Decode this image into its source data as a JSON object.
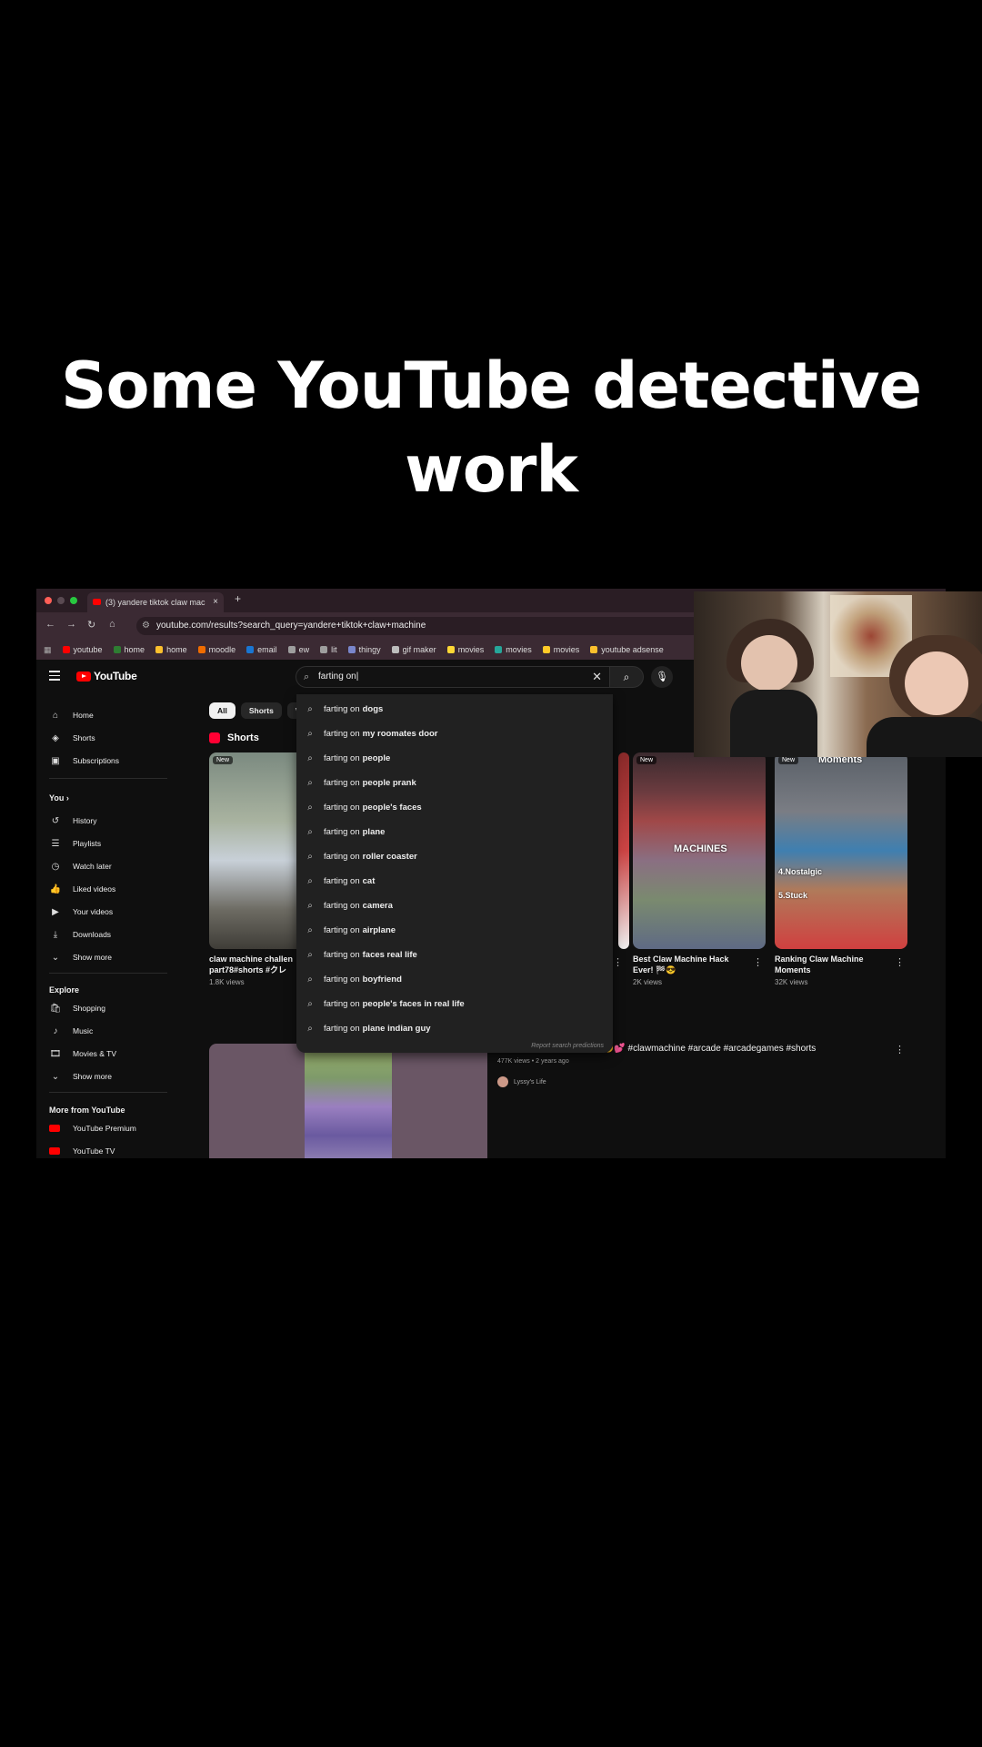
{
  "caption": "Some YouTube detective work",
  "browser": {
    "tab_title": "(3) yandere tiktok claw mac",
    "tab_close": "×",
    "new_tab": "+",
    "url": "youtube.com/results?search_query=yandere+tiktok+claw+machine",
    "bookmarks": [
      {
        "label": "youtube",
        "color": "#ff0000"
      },
      {
        "label": "home",
        "color": "#2e7d32"
      },
      {
        "label": "home",
        "color": "#fbc02d"
      },
      {
        "label": "moodle",
        "color": "#ef6c00"
      },
      {
        "label": "email",
        "color": "#1976d2"
      },
      {
        "label": "ew",
        "color": "#9e9e9e"
      },
      {
        "label": "lit",
        "color": "#9e9e9e"
      },
      {
        "label": "thingy",
        "color": "#7986cb"
      },
      {
        "label": "gif maker",
        "color": "#bdbdbd"
      },
      {
        "label": "movies",
        "color": "#fdd835"
      },
      {
        "label": "movies",
        "color": "#26a69a"
      },
      {
        "label": "movies",
        "color": "#ffca28"
      },
      {
        "label": "youtube adsense",
        "color": "#fbc02d"
      }
    ]
  },
  "youtube": {
    "logo_text": "YouTube",
    "search_value": "farting on|",
    "search_clear": "✕",
    "sidebar": {
      "main": [
        "Home",
        "Shorts",
        "Subscriptions"
      ],
      "you_header": "You ›",
      "you": [
        "History",
        "Playlists",
        "Watch later",
        "Liked videos",
        "Your videos",
        "Downloads",
        "Show more"
      ],
      "explore_header": "Explore",
      "explore": [
        "Shopping",
        "Music",
        "Movies & TV",
        "Show more"
      ],
      "more_header": "More from YouTube",
      "more": [
        "YouTube Premium",
        "YouTube TV"
      ]
    },
    "chips": [
      "All",
      "Shorts",
      "Vid"
    ],
    "shorts_heading": "Shorts",
    "shorts": [
      {
        "badge": "New",
        "title": "claw machine challen part78#shorts #クレ",
        "views": "1.8K views",
        "overlay": ""
      },
      {
        "badge": "New",
        "title": "Best Claw Machine Hack Ever! 🏁😎",
        "views": "2K views",
        "overlay": "MACHINES"
      },
      {
        "badge": "New",
        "title": "Ranking Claw Machine Moments",
        "views": "32K views",
        "overlay": "Moments"
      }
    ],
    "short3_ranks": [
      "4.Nostalgic",
      "5.Stuck"
    ],
    "video": {
      "title": "Winning Arcade Prizes 🎰😍💕 #clawmachine #arcade #arcadegames #shorts",
      "meta": "477K views • 2 years ago",
      "channel": "Lyssy's Life"
    },
    "suggestions": [
      {
        "prefix": "farting on",
        "rest": "dogs"
      },
      {
        "prefix": "farting on",
        "rest": "my roomates door"
      },
      {
        "prefix": "farting on",
        "rest": "people"
      },
      {
        "prefix": "farting on",
        "rest": "people prank"
      },
      {
        "prefix": "farting on",
        "rest": "people's faces"
      },
      {
        "prefix": "farting on",
        "rest": "plane"
      },
      {
        "prefix": "farting on",
        "rest": "roller coaster"
      },
      {
        "prefix": "farting on",
        "rest": "cat"
      },
      {
        "prefix": "farting on",
        "rest": "camera"
      },
      {
        "prefix": "farting on",
        "rest": "airplane"
      },
      {
        "prefix": "farting on",
        "rest": "faces real life"
      },
      {
        "prefix": "farting on",
        "rest": "boyfriend"
      },
      {
        "prefix": "farting on",
        "rest": "people's faces in real life"
      },
      {
        "prefix": "farting on",
        "rest": "plane indian guy"
      }
    ],
    "report_text": "Report search predictions"
  }
}
